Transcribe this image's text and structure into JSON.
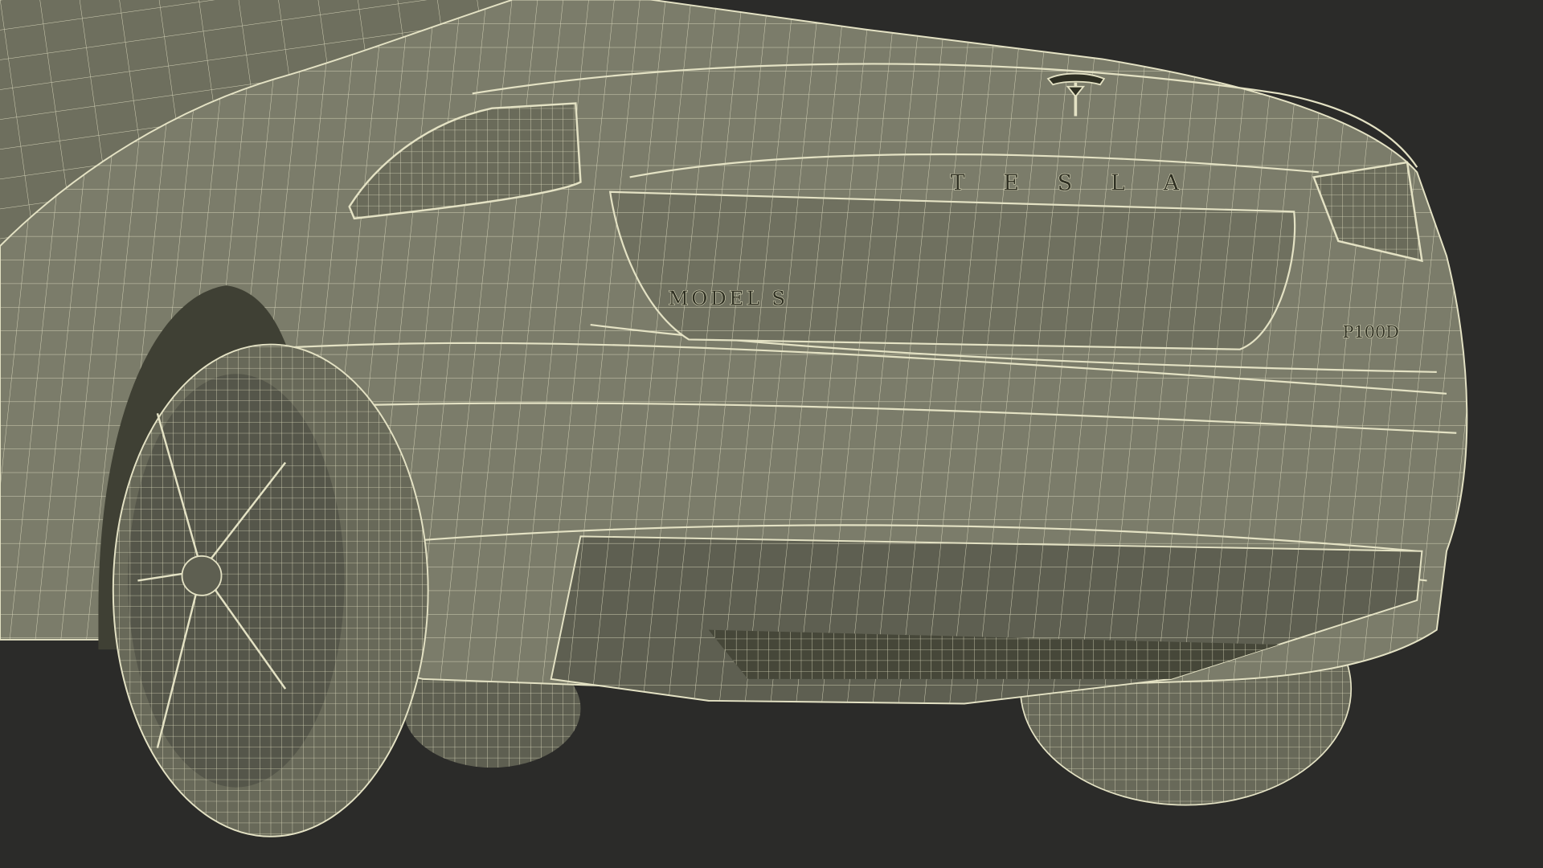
{
  "scene": {
    "subject": "wireframe-3d-render",
    "colors": {
      "background": "#2b2b29",
      "surface": "#7b7c6a",
      "surface_shadow": "#5e5f51",
      "surface_dark": "#464739",
      "wire": "#e4e2c4",
      "badge_dark": "#2f3023"
    }
  },
  "badges": {
    "wordmark": "T E S L A",
    "model": "MODEL S",
    "variant": "P100D"
  }
}
